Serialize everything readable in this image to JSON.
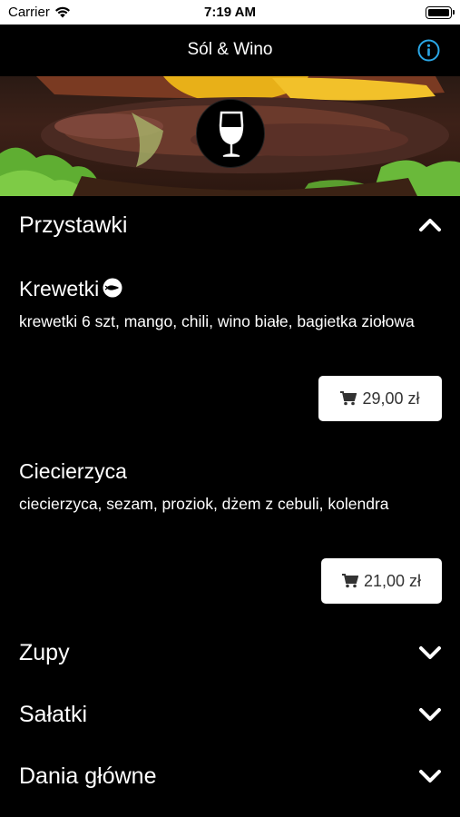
{
  "status_bar": {
    "carrier": "Carrier",
    "time": "7:19 AM",
    "battery_level": 1.0
  },
  "nav": {
    "title": "Sól & Wino",
    "info_icon": "info-circle-icon",
    "accent_color": "#2AA7E6"
  },
  "hero": {
    "logo_icon": "wine-glass-icon"
  },
  "sections": [
    {
      "title": "Przystawki",
      "expanded": true,
      "items": [
        {
          "name": "Krewetki",
          "badge_icon": "shrimp-icon",
          "description": "krewetki 6 szt, mango, chili, wino białe, bagietka ziołowa",
          "price": "29,00 zł"
        },
        {
          "name": "Ciecierzyca",
          "description": "ciecierzyca, sezam, proziok, dżem z cebuli, kolendra",
          "price": "21,00 zł"
        }
      ]
    },
    {
      "title": "Zupy",
      "expanded": false
    },
    {
      "title": "Sałatki",
      "expanded": false
    },
    {
      "title": "Dania główne",
      "expanded": false
    }
  ],
  "cart_icon": "cart-icon"
}
